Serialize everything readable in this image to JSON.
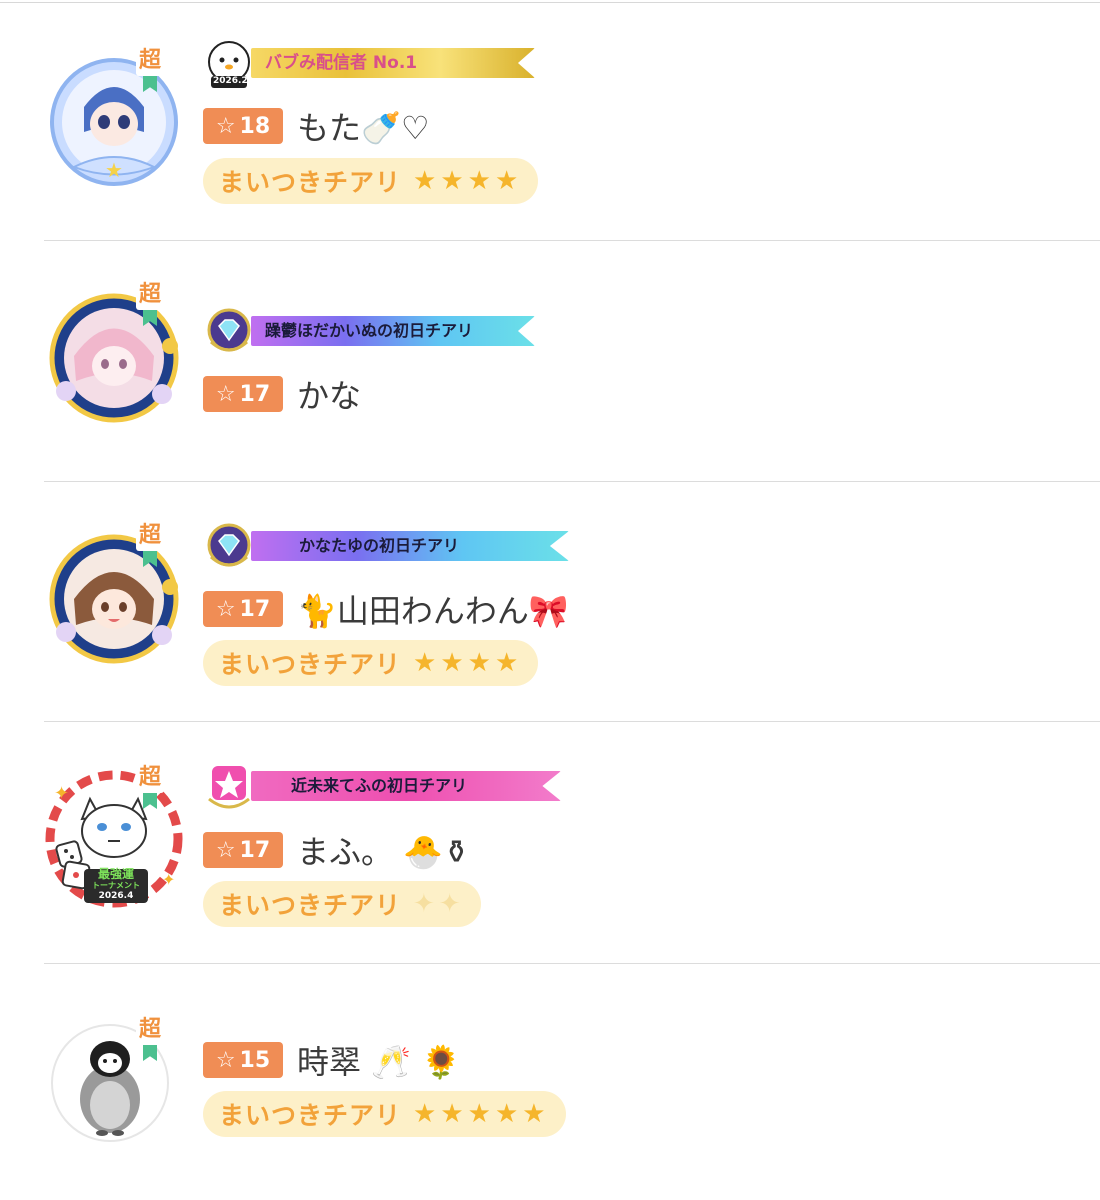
{
  "super_label": "超",
  "level_star": "☆",
  "rows": [
    {
      "banner_text": "バブみ配信者 No.1",
      "banner_emblem_text": "2026.2",
      "level": "18",
      "name": "もた🍼♡",
      "cheer": "まいつきチアリ",
      "cheer_stars": "★★★★"
    },
    {
      "banner_text": "躁鬱ほだかいぬの初日チアリ",
      "level": "17",
      "name": "かな"
    },
    {
      "banner_text": "かなたゆの初日チアリ",
      "level": "17",
      "name": "🐈山田わんわん🎀",
      "cheer": "まいつきチアリ",
      "cheer_stars": "★★★★"
    },
    {
      "banner_text": "近未来てふの初日チアリ",
      "avatar_badge_text": "最強運",
      "avatar_badge_sub": "トーナメント",
      "avatar_badge_date": "2026.4",
      "level": "17",
      "name": "まふ。 🐣⚱",
      "cheer": "まいつきチアリ",
      "cheer_stars": "✦✦"
    },
    {
      "level": "15",
      "name": "時翠 🥂 🌻",
      "cheer": "まいつきチアリ",
      "cheer_stars": "★★★★★"
    }
  ],
  "colors": {
    "level_badge": "#f08d55",
    "cheer_bg": "#fdf0c8",
    "cheer_text": "#f2a23a",
    "star": "#f5b52c",
    "super": "#f0913d"
  }
}
